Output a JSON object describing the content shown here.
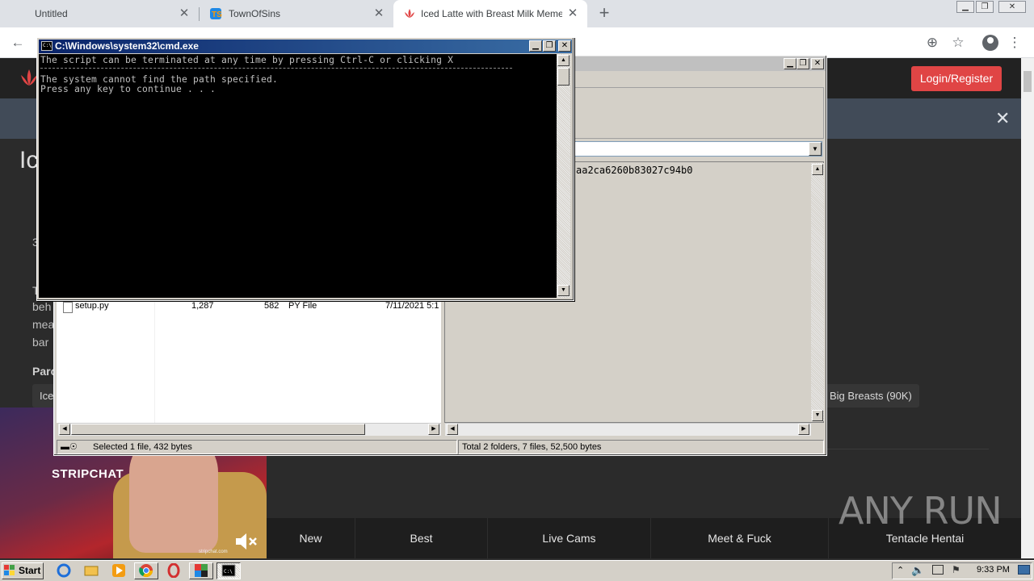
{
  "browser": {
    "tabs": [
      {
        "label": "Untitled",
        "active": false
      },
      {
        "label": "TownOfSins",
        "active": false
      },
      {
        "label": "Iced Latte with Breast Milk Meme | Li",
        "active": true
      }
    ],
    "new_tab_symbol": "+",
    "close_symbol": "✕",
    "window_controls": {
      "minimize": "▁",
      "restore": "❐",
      "close": "✕"
    }
  },
  "site": {
    "login_button": "Login/Register",
    "banner_close": "✕",
    "title_fragment": "Ic",
    "text_fragments": [
      "T",
      "beh",
      "mea",
      "bar",
      "3",
      "Parc"
    ],
    "tags": [
      "Ice",
      "Big Breasts (90K)"
    ],
    "bottom_nav": [
      "New",
      "Best",
      "Live Cams",
      "Meet & Fuck",
      "Tentacle Hentai"
    ],
    "ad": {
      "brand": "STRIPCHAT",
      "caption": "stripchat.com"
    },
    "brand_color": "#e04545"
  },
  "file_manager": {
    "right_pane_text": "aa2ca6260b83027c94b0",
    "file_row": {
      "name": "setup.py",
      "size": "1,287",
      "packed": "582",
      "type": "PY File",
      "modified": "7/11/2021 5:1"
    },
    "status_left": "Selected 1 file, 432 bytes",
    "status_right": "Total 2 folders, 7 files, 52,500 bytes"
  },
  "cmd": {
    "title": "C:\\Windows\\system32\\cmd.exe",
    "lines": [
      "The script can be terminated at any time by pressing Ctrl-C or clicking X",
      "The system cannot find the path specified.",
      "Press any key to continue . . ."
    ]
  },
  "taskbar": {
    "start_label": "Start",
    "clock": "9:33 PM"
  },
  "watermark": "ANY RUN"
}
